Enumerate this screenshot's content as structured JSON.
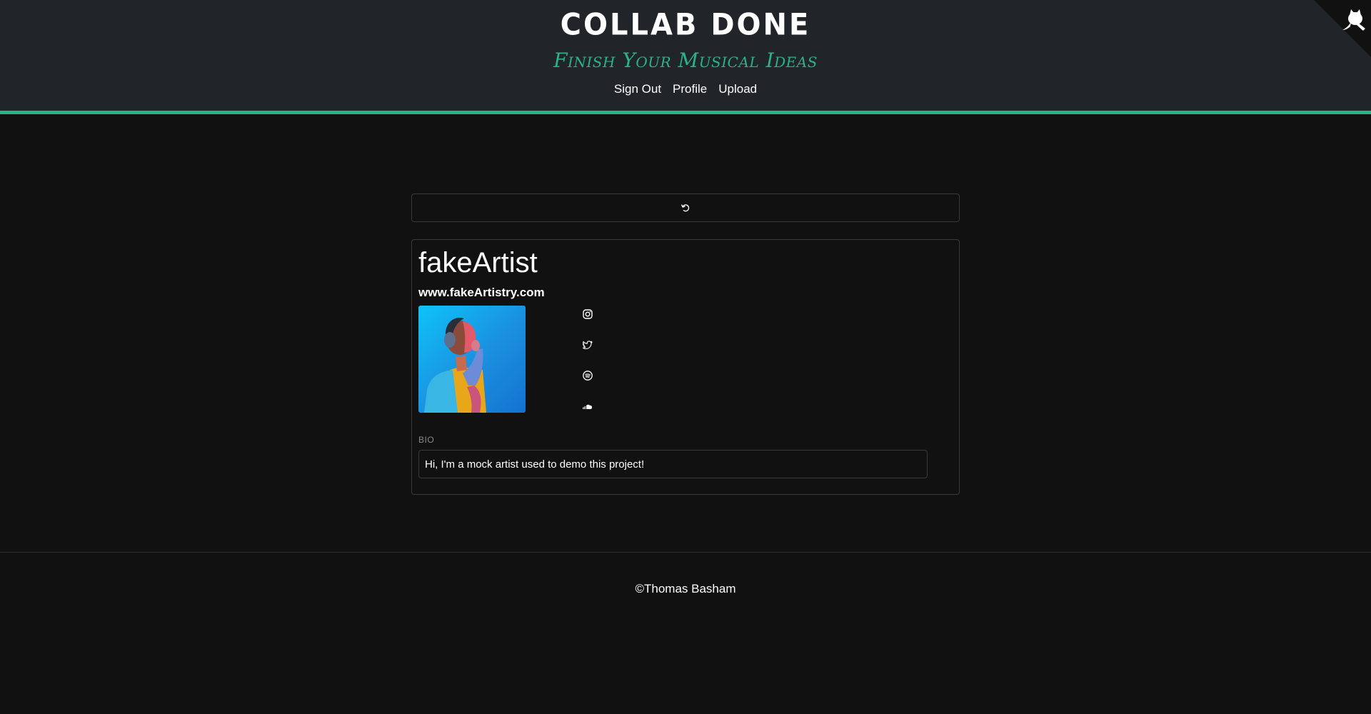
{
  "header": {
    "title": "COLLAB DONE",
    "tagline": "Finish Your Musical Ideas",
    "nav": [
      "Sign Out",
      "Profile",
      "Upload"
    ]
  },
  "refresh": {
    "icon": "refresh-icon"
  },
  "profile": {
    "name": "fakeArtist",
    "website": "www.fakeArtistry.com",
    "socials": [
      "instagram-icon",
      "twitter-icon",
      "spotify-icon",
      "soundcloud-icon"
    ],
    "bio_label": "BIO",
    "bio": "Hi, I'm a mock artist used to demo this project!"
  },
  "footer": {
    "copyright": "©Thomas Basham"
  },
  "colors": {
    "accent": "#2bb286",
    "header_bg": "#212429",
    "page_bg": "#111111"
  }
}
